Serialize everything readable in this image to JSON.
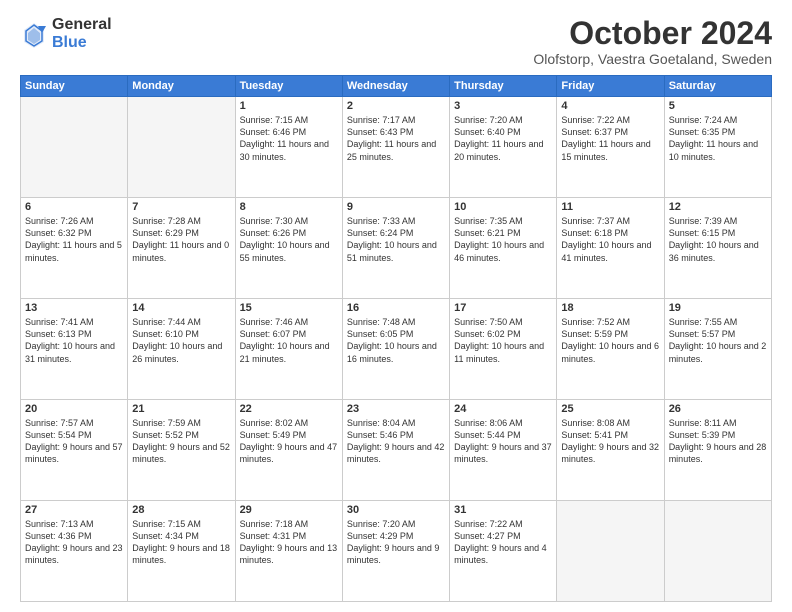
{
  "logo": {
    "line1": "General",
    "line2": "Blue"
  },
  "title": "October 2024",
  "subtitle": "Olofstorp, Vaestra Goetaland, Sweden",
  "days_of_week": [
    "Sunday",
    "Monday",
    "Tuesday",
    "Wednesday",
    "Thursday",
    "Friday",
    "Saturday"
  ],
  "weeks": [
    [
      {
        "day": "",
        "empty": true
      },
      {
        "day": "",
        "empty": true
      },
      {
        "day": "1",
        "sunrise": "Sunrise: 7:15 AM",
        "sunset": "Sunset: 6:46 PM",
        "daylight": "Daylight: 11 hours and 30 minutes."
      },
      {
        "day": "2",
        "sunrise": "Sunrise: 7:17 AM",
        "sunset": "Sunset: 6:43 PM",
        "daylight": "Daylight: 11 hours and 25 minutes."
      },
      {
        "day": "3",
        "sunrise": "Sunrise: 7:20 AM",
        "sunset": "Sunset: 6:40 PM",
        "daylight": "Daylight: 11 hours and 20 minutes."
      },
      {
        "day": "4",
        "sunrise": "Sunrise: 7:22 AM",
        "sunset": "Sunset: 6:37 PM",
        "daylight": "Daylight: 11 hours and 15 minutes."
      },
      {
        "day": "5",
        "sunrise": "Sunrise: 7:24 AM",
        "sunset": "Sunset: 6:35 PM",
        "daylight": "Daylight: 11 hours and 10 minutes."
      }
    ],
    [
      {
        "day": "6",
        "sunrise": "Sunrise: 7:26 AM",
        "sunset": "Sunset: 6:32 PM",
        "daylight": "Daylight: 11 hours and 5 minutes."
      },
      {
        "day": "7",
        "sunrise": "Sunrise: 7:28 AM",
        "sunset": "Sunset: 6:29 PM",
        "daylight": "Daylight: 11 hours and 0 minutes."
      },
      {
        "day": "8",
        "sunrise": "Sunrise: 7:30 AM",
        "sunset": "Sunset: 6:26 PM",
        "daylight": "Daylight: 10 hours and 55 minutes."
      },
      {
        "day": "9",
        "sunrise": "Sunrise: 7:33 AM",
        "sunset": "Sunset: 6:24 PM",
        "daylight": "Daylight: 10 hours and 51 minutes."
      },
      {
        "day": "10",
        "sunrise": "Sunrise: 7:35 AM",
        "sunset": "Sunset: 6:21 PM",
        "daylight": "Daylight: 10 hours and 46 minutes."
      },
      {
        "day": "11",
        "sunrise": "Sunrise: 7:37 AM",
        "sunset": "Sunset: 6:18 PM",
        "daylight": "Daylight: 10 hours and 41 minutes."
      },
      {
        "day": "12",
        "sunrise": "Sunrise: 7:39 AM",
        "sunset": "Sunset: 6:15 PM",
        "daylight": "Daylight: 10 hours and 36 minutes."
      }
    ],
    [
      {
        "day": "13",
        "sunrise": "Sunrise: 7:41 AM",
        "sunset": "Sunset: 6:13 PM",
        "daylight": "Daylight: 10 hours and 31 minutes."
      },
      {
        "day": "14",
        "sunrise": "Sunrise: 7:44 AM",
        "sunset": "Sunset: 6:10 PM",
        "daylight": "Daylight: 10 hours and 26 minutes."
      },
      {
        "day": "15",
        "sunrise": "Sunrise: 7:46 AM",
        "sunset": "Sunset: 6:07 PM",
        "daylight": "Daylight: 10 hours and 21 minutes."
      },
      {
        "day": "16",
        "sunrise": "Sunrise: 7:48 AM",
        "sunset": "Sunset: 6:05 PM",
        "daylight": "Daylight: 10 hours and 16 minutes."
      },
      {
        "day": "17",
        "sunrise": "Sunrise: 7:50 AM",
        "sunset": "Sunset: 6:02 PM",
        "daylight": "Daylight: 10 hours and 11 minutes."
      },
      {
        "day": "18",
        "sunrise": "Sunrise: 7:52 AM",
        "sunset": "Sunset: 5:59 PM",
        "daylight": "Daylight: 10 hours and 6 minutes."
      },
      {
        "day": "19",
        "sunrise": "Sunrise: 7:55 AM",
        "sunset": "Sunset: 5:57 PM",
        "daylight": "Daylight: 10 hours and 2 minutes."
      }
    ],
    [
      {
        "day": "20",
        "sunrise": "Sunrise: 7:57 AM",
        "sunset": "Sunset: 5:54 PM",
        "daylight": "Daylight: 9 hours and 57 minutes."
      },
      {
        "day": "21",
        "sunrise": "Sunrise: 7:59 AM",
        "sunset": "Sunset: 5:52 PM",
        "daylight": "Daylight: 9 hours and 52 minutes."
      },
      {
        "day": "22",
        "sunrise": "Sunrise: 8:02 AM",
        "sunset": "Sunset: 5:49 PM",
        "daylight": "Daylight: 9 hours and 47 minutes."
      },
      {
        "day": "23",
        "sunrise": "Sunrise: 8:04 AM",
        "sunset": "Sunset: 5:46 PM",
        "daylight": "Daylight: 9 hours and 42 minutes."
      },
      {
        "day": "24",
        "sunrise": "Sunrise: 8:06 AM",
        "sunset": "Sunset: 5:44 PM",
        "daylight": "Daylight: 9 hours and 37 minutes."
      },
      {
        "day": "25",
        "sunrise": "Sunrise: 8:08 AM",
        "sunset": "Sunset: 5:41 PM",
        "daylight": "Daylight: 9 hours and 32 minutes."
      },
      {
        "day": "26",
        "sunrise": "Sunrise: 8:11 AM",
        "sunset": "Sunset: 5:39 PM",
        "daylight": "Daylight: 9 hours and 28 minutes."
      }
    ],
    [
      {
        "day": "27",
        "sunrise": "Sunrise: 7:13 AM",
        "sunset": "Sunset: 4:36 PM",
        "daylight": "Daylight: 9 hours and 23 minutes."
      },
      {
        "day": "28",
        "sunrise": "Sunrise: 7:15 AM",
        "sunset": "Sunset: 4:34 PM",
        "daylight": "Daylight: 9 hours and 18 minutes."
      },
      {
        "day": "29",
        "sunrise": "Sunrise: 7:18 AM",
        "sunset": "Sunset: 4:31 PM",
        "daylight": "Daylight: 9 hours and 13 minutes."
      },
      {
        "day": "30",
        "sunrise": "Sunrise: 7:20 AM",
        "sunset": "Sunset: 4:29 PM",
        "daylight": "Daylight: 9 hours and 9 minutes."
      },
      {
        "day": "31",
        "sunrise": "Sunrise: 7:22 AM",
        "sunset": "Sunset: 4:27 PM",
        "daylight": "Daylight: 9 hours and 4 minutes."
      },
      {
        "day": "",
        "empty": true
      },
      {
        "day": "",
        "empty": true
      }
    ]
  ]
}
